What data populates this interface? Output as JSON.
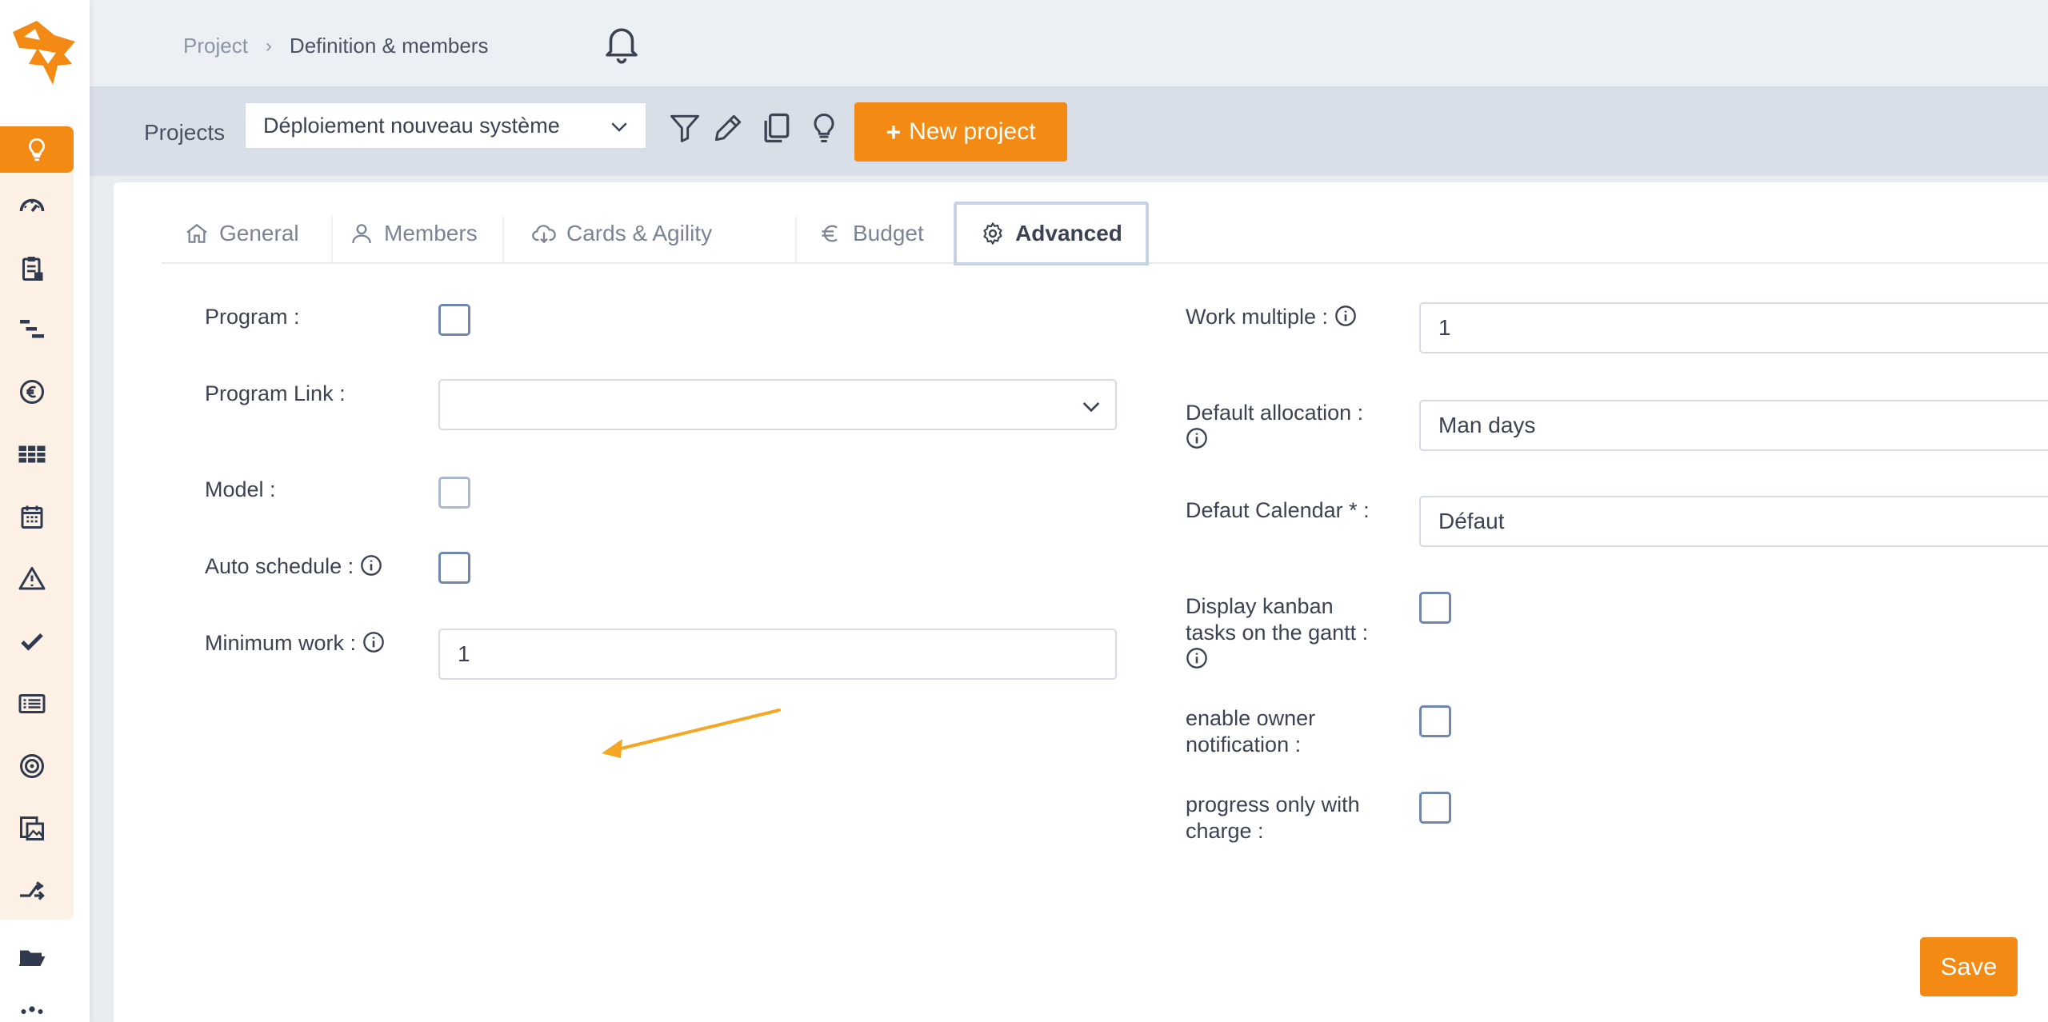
{
  "breadcrumb": {
    "project": "Project",
    "separator": "›",
    "current": "Definition & members"
  },
  "projects_bar": {
    "label": "Projects",
    "selected_project": "Déploiement nouveau système",
    "new_project_label": "New project",
    "new_project_icon": "+"
  },
  "tabs": [
    {
      "label": "General",
      "icon": "home-icon"
    },
    {
      "label": "Members",
      "icon": "user-icon"
    },
    {
      "label": "Cards & Agility",
      "icon": "cloud-download-icon"
    },
    {
      "label": "Budget",
      "icon": "euro-icon"
    },
    {
      "label": "Advanced",
      "icon": "gear-icon",
      "active": true
    }
  ],
  "left_fields": {
    "program": {
      "label": "Program :",
      "checked": false
    },
    "program_link": {
      "label": "Program Link :",
      "value": ""
    },
    "model": {
      "label": "Model :",
      "checked": false
    },
    "auto_schedule": {
      "label": "Auto schedule :",
      "checked": false
    },
    "minimum_work": {
      "label": "Minimum work :",
      "value": "1"
    }
  },
  "right_fields": {
    "work_multiple": {
      "label": "Work multiple :",
      "value": "1"
    },
    "default_allocation": {
      "label": "Default allocation :",
      "value": "Man days"
    },
    "default_calendar": {
      "label": "Defaut Calendar * :",
      "value": "Défaut"
    },
    "display_kanban": {
      "label_line1": "Display kanban",
      "label_line2": "tasks on the gantt :",
      "checked": false
    },
    "owner_notification": {
      "label_line1": "enable owner",
      "label_line2": "notification :",
      "checked": false
    },
    "progress_charge": {
      "label_line1": "progress only with",
      "label_line2": "charge :",
      "checked": false
    }
  },
  "save_label": "Save",
  "colors": {
    "accent": "#f28a13",
    "sidebar_tint": "#fdf0e4",
    "checkbox_border": "#6f87ae",
    "annotation_arrow": "#f5a623"
  }
}
